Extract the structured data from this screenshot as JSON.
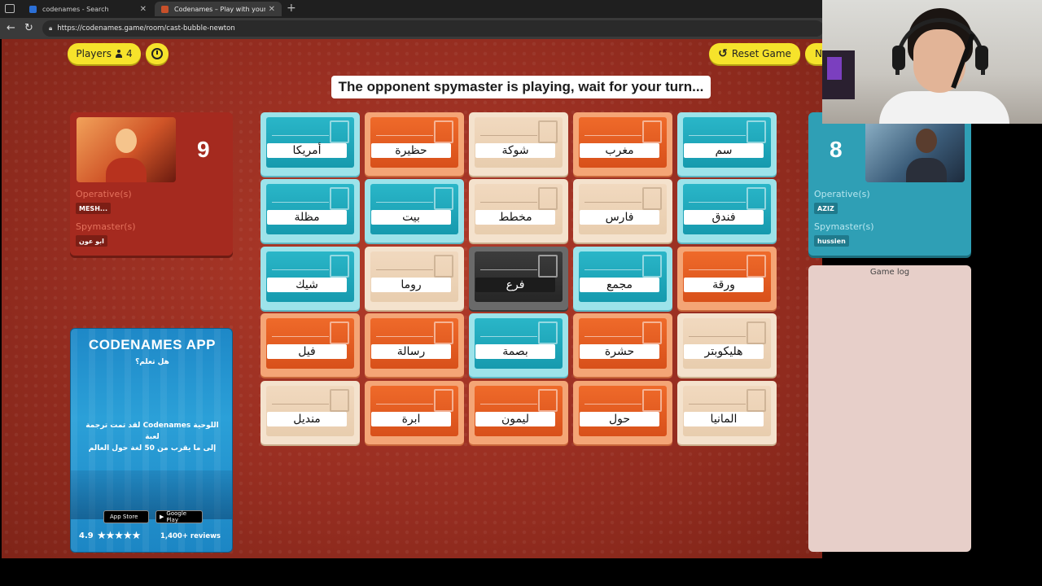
{
  "browser": {
    "tabs": [
      {
        "title": "codenames - Search",
        "favicon_color": "#2b6fd6"
      },
      {
        "title": "Codenames – Play with your Friends",
        "favicon_color": "#c8502a"
      }
    ],
    "url": "https://codenames.game/room/cast-bubble-newton"
  },
  "toolbar": {
    "players_label": "Players",
    "players_count": "4",
    "reset_label": "Reset Game",
    "next_label": "N"
  },
  "banner": "The opponent spymaster is playing, wait for your turn...",
  "red_team": {
    "score": "9",
    "operatives_label": "Operative(s)",
    "operatives": [
      "MESH..."
    ],
    "spymasters_label": "Spymaster(s)",
    "spymasters": [
      "ابو عون"
    ]
  },
  "blue_team": {
    "score": "8",
    "operatives_label": "Operative(s)",
    "operatives": [
      "AZIZ"
    ],
    "spymasters_label": "Spymaster(s)",
    "spymasters": [
      "hussien"
    ]
  },
  "game_log": {
    "title": "Game log"
  },
  "app_ad": {
    "title": "CODENAMES APP",
    "question": "هل تعلم؟",
    "desc_line1": "اللوحية Codenames لقد تمت ترجمة لعبة",
    "desc_line2": "إلى ما يقرب من 50 لغة حول العالم",
    "app_store": "App Store",
    "google_play": "Google Play",
    "rating": "4.9",
    "stars": "★★★★★",
    "reviews": "1,400+ reviews"
  },
  "colors": {
    "red_agent": "#ef6a2a",
    "blue_agent": "#2ab6c8",
    "neutral": "#f1d9bf",
    "assassin": "#2e2e2e",
    "pill_yellow": "#f6e32b"
  },
  "board": [
    {
      "word": "أمريكا",
      "type": "blue"
    },
    {
      "word": "حظيرة",
      "type": "red"
    },
    {
      "word": "شوكة",
      "type": "neutral"
    },
    {
      "word": "مغرب",
      "type": "red"
    },
    {
      "word": "سم",
      "type": "blue"
    },
    {
      "word": "مظلة",
      "type": "blue"
    },
    {
      "word": "بيت",
      "type": "blue"
    },
    {
      "word": "مخطط",
      "type": "neutral"
    },
    {
      "word": "فارس",
      "type": "neutral"
    },
    {
      "word": "فندق",
      "type": "blue"
    },
    {
      "word": "شيك",
      "type": "blue"
    },
    {
      "word": "روما",
      "type": "neutral"
    },
    {
      "word": "فرع",
      "type": "assassin"
    },
    {
      "word": "مجمع",
      "type": "blue"
    },
    {
      "word": "ورقة",
      "type": "red"
    },
    {
      "word": "فيل",
      "type": "red"
    },
    {
      "word": "رسالة",
      "type": "red"
    },
    {
      "word": "بصمة",
      "type": "blue"
    },
    {
      "word": "حشرة",
      "type": "red"
    },
    {
      "word": "هليكوبتر",
      "type": "neutral"
    },
    {
      "word": "منديل",
      "type": "neutral"
    },
    {
      "word": "ابرة",
      "type": "red"
    },
    {
      "word": "ليمون",
      "type": "red"
    },
    {
      "word": "حول",
      "type": "red"
    },
    {
      "word": "المانيا",
      "type": "neutral"
    }
  ]
}
